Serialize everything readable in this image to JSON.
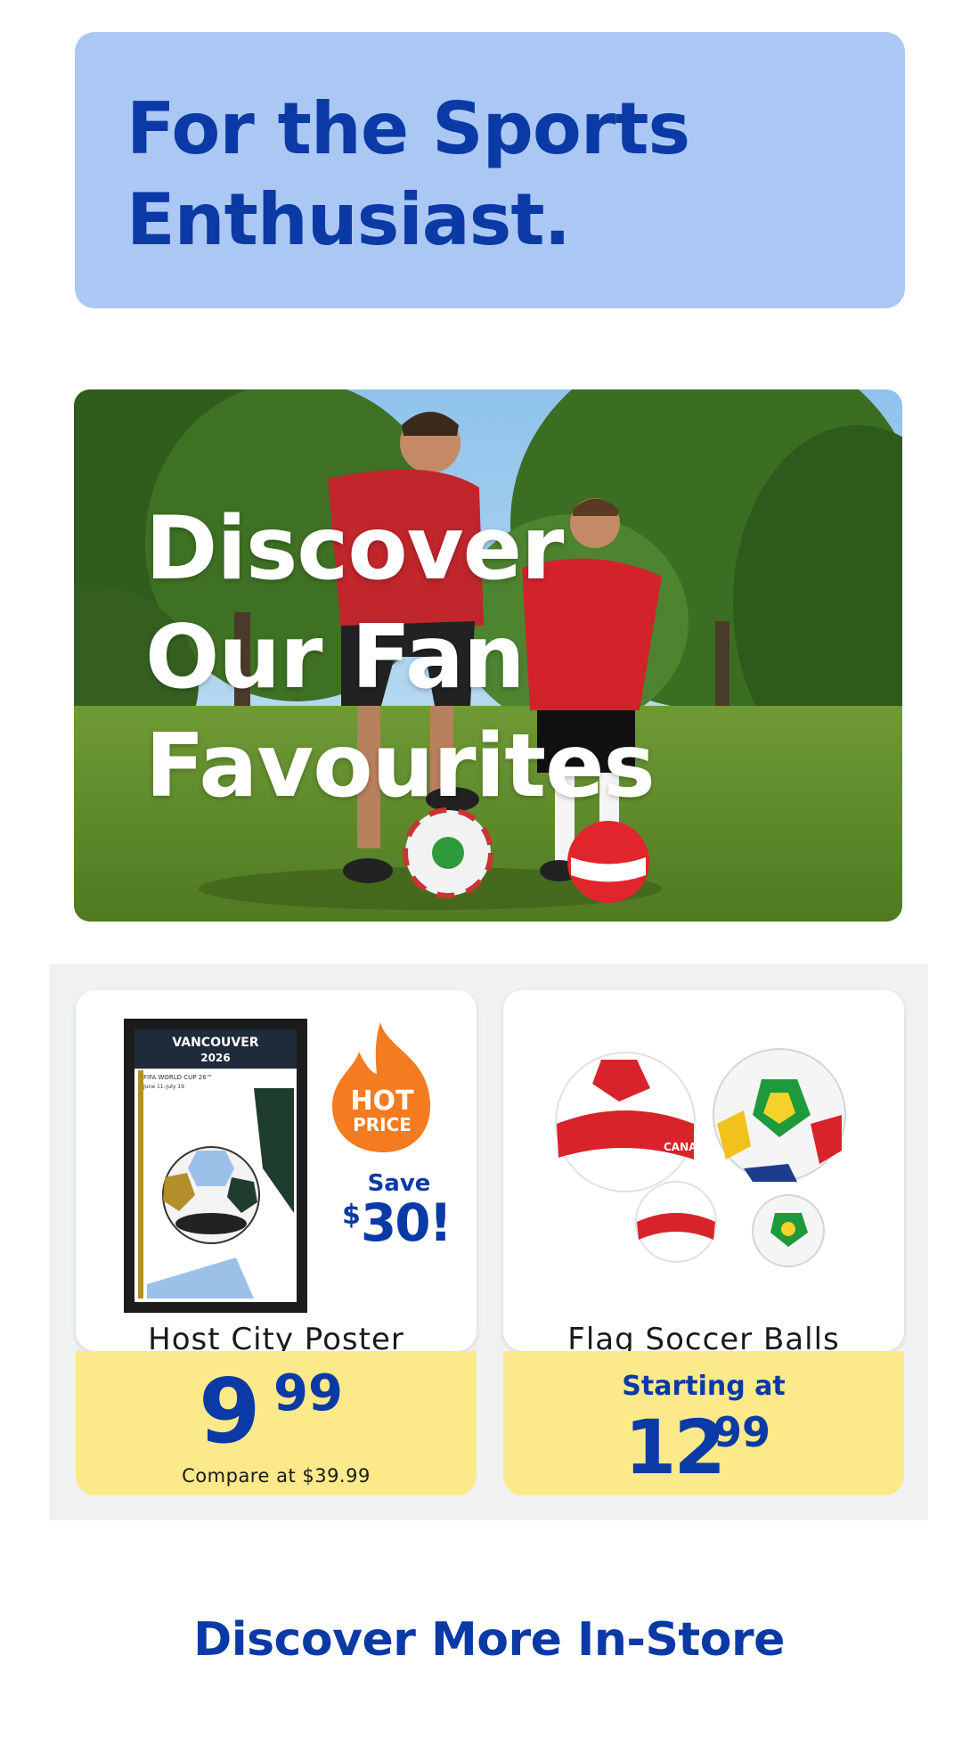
{
  "header": {
    "title_line1": "For the Sports",
    "title_line2": "Enthusiast."
  },
  "banner": {
    "line1": "Discover",
    "line2": "Our Fan",
    "line3": "Favourites"
  },
  "products": [
    {
      "name": "Host City Poster",
      "badge_top": "HOT",
      "badge_bottom": "PRICE",
      "save_label": "Save",
      "save_currency": "$",
      "save_amount": "30!",
      "poster_city": "VANCOUVER",
      "poster_year": "2026",
      "poster_sub": "FIFA WORLD CUP 26™",
      "poster_dates": "June 11–July 19",
      "price_dollars": "9",
      "price_cents": "99",
      "compare": "Compare at $39.99"
    },
    {
      "name": "Flag Soccer Balls",
      "ball_text": "CANADA",
      "price_prefix": "Starting at",
      "price_dollars": "12",
      "price_cents": "99"
    }
  ],
  "cta": "Discover More In-Store",
  "colors": {
    "brand_blue": "#0b3aa6",
    "header_bg": "#abc8f4",
    "price_bg": "#fbe98a",
    "hot_orange": "#f47b20"
  }
}
